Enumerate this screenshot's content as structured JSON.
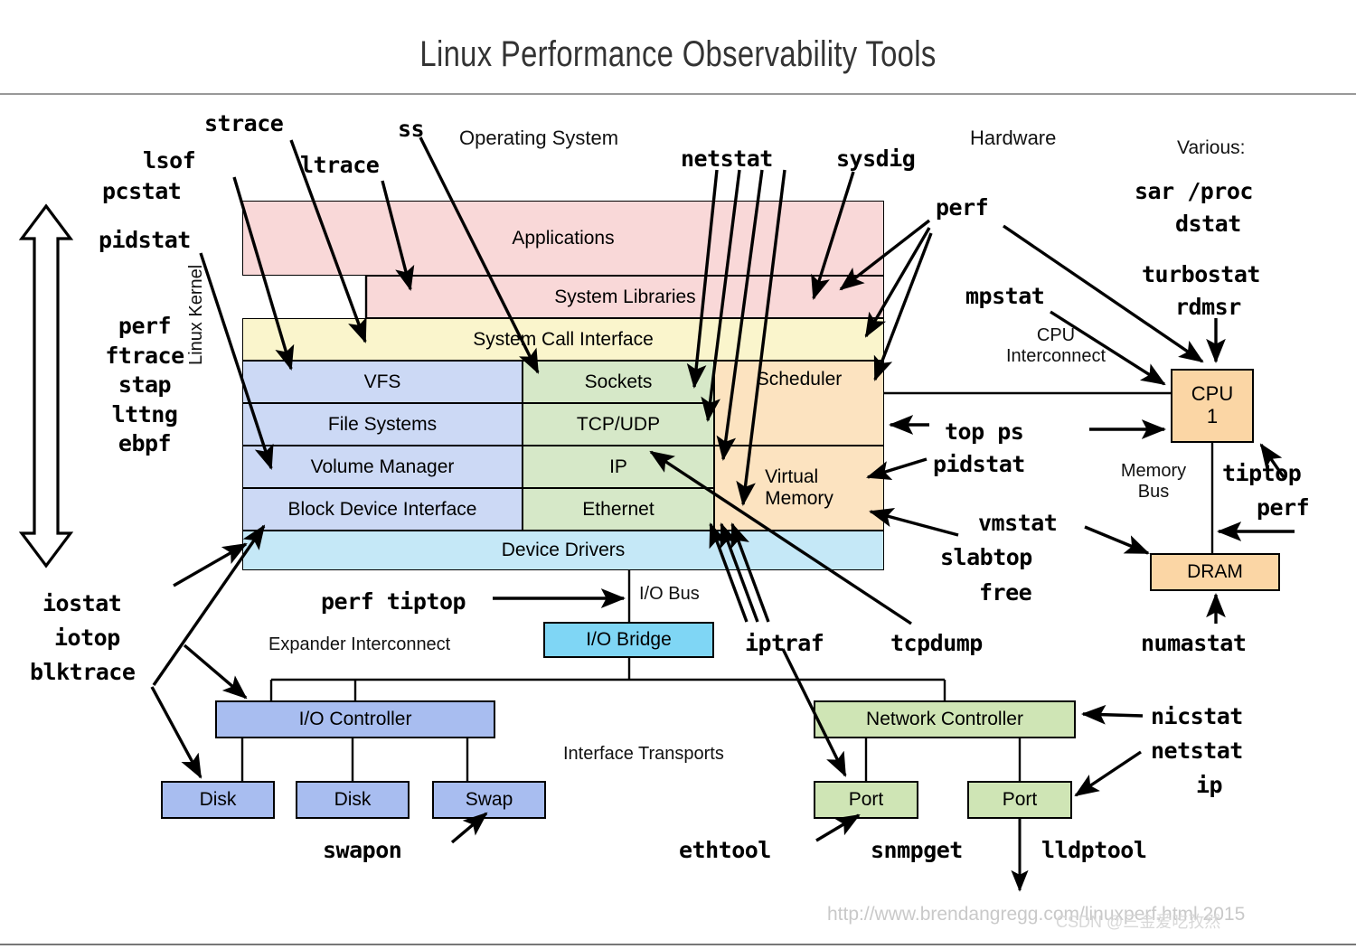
{
  "title": "Linux Performance Observability Tools",
  "section_labels": {
    "operating_system": "Operating System",
    "hardware": "Hardware",
    "various": "Various:",
    "linux_kernel": "Linux Kernel",
    "cpu_interconnect": "CPU\nInterconnect",
    "memory_bus": "Memory\nBus",
    "io_bus": "I/O Bus",
    "expander_interconnect": "Expander Interconnect",
    "interface_transports": "Interface Transports"
  },
  "stack": {
    "applications": "Applications",
    "system_libraries": "System Libraries",
    "system_call_interface": "System Call Interface",
    "vfs": "VFS",
    "file_systems": "File Systems",
    "volume_manager": "Volume Manager",
    "block_device_interface": "Block Device Interface",
    "sockets": "Sockets",
    "tcp_udp": "TCP/UDP",
    "ip": "IP",
    "ethernet": "Ethernet",
    "scheduler": "Scheduler",
    "virtual_memory": "Virtual\nMemory",
    "device_drivers": "Device Drivers"
  },
  "hardware": {
    "cpu": "CPU\n1",
    "dram": "DRAM",
    "io_bridge": "I/O Bridge",
    "io_controller": "I/O Controller",
    "disk1": "Disk",
    "disk2": "Disk",
    "swap": "Swap",
    "network_controller": "Network Controller",
    "port1": "Port",
    "port2": "Port"
  },
  "tools": {
    "strace": "strace",
    "ss": "ss",
    "lsof": "lsof",
    "pcstat": "pcstat",
    "ltrace": "ltrace",
    "netstat_top": "netstat",
    "sysdig": "sysdig",
    "perf_hw": "perf",
    "pidstat_left": "pidstat",
    "sar_proc": "sar /proc",
    "dstat": "dstat",
    "turbostat": "turbostat",
    "rdmsr": "rdmsr",
    "mpstat": "mpstat",
    "kernel_tracers": "perf\nftrace\nstap\nlttng\nebpf",
    "top_ps": "top ps",
    "pidstat_right": "pidstat",
    "tiptop_right": "tiptop",
    "perf_right": "perf",
    "vmstat": "vmstat",
    "slabtop": "slabtop",
    "free": "free",
    "numastat": "numastat",
    "iostat": "iostat",
    "iotop": "iotop",
    "blktrace": "blktrace",
    "perf_tiptop": "perf tiptop",
    "iptraf": "iptraf",
    "tcpdump": "tcpdump",
    "swapon": "swapon",
    "nicstat": "nicstat",
    "netstat_net": "netstat",
    "ip": "ip",
    "ethtool": "ethtool",
    "snmpget": "snmpget",
    "lldptool": "lldptool"
  },
  "footer": {
    "url": "http://www.brendangregg.com/linuxperf.html 2015",
    "watermark": "CSDN @三金爱吃孜然"
  },
  "colors": {
    "applications": "#f9d8d8",
    "syscall": "#faf5cc",
    "filesystem": "#ccd9f5",
    "network": "#d6e8c8",
    "cpu_mem": "#fce3c0",
    "device_drivers": "#c5e8f7",
    "io_bridge": "#7fd6f5",
    "io_blue": "#a8bdf0",
    "net_green": "#cfe5b5",
    "hw_orange": "#fbd6a5"
  }
}
